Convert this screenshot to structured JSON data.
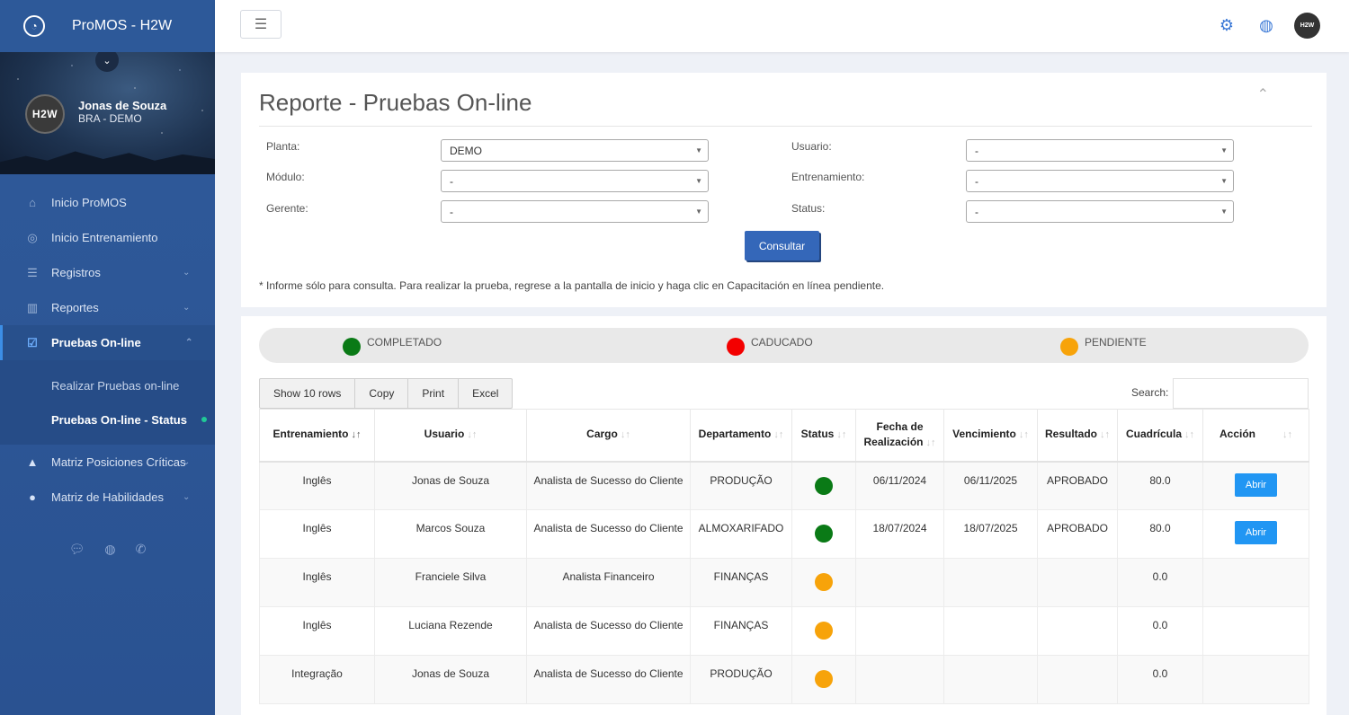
{
  "app": {
    "title": "ProMOS - H2W"
  },
  "profile": {
    "initials": "H2W",
    "name": "Jonas de Souza",
    "org": "BRA - DEMO"
  },
  "menu": [
    {
      "label": "Inicio ProMOS"
    },
    {
      "label": "Inicio Entrenamiento"
    },
    {
      "label": "Registros"
    },
    {
      "label": "Reportes"
    },
    {
      "label": "Pruebas On-line"
    },
    {
      "label": "Matriz Posiciones Críticas"
    },
    {
      "label": "Matriz de Habilidades"
    }
  ],
  "submenu": [
    {
      "label": "Realizar Pruebas on-line"
    },
    {
      "label": "Pruebas On-line - Status"
    }
  ],
  "topbar": {
    "avatar": "H2W"
  },
  "report": {
    "title": "Reporte - Pruebas On-line",
    "filters": {
      "planta": {
        "label": "Planta:",
        "value": "DEMO"
      },
      "modulo": {
        "label": "Módulo:",
        "value": "-"
      },
      "gerente": {
        "label": "Gerente:",
        "value": "-"
      },
      "usuario": {
        "label": "Usuario:",
        "value": "-"
      },
      "entrenamiento": {
        "label": "Entrenamiento:",
        "value": "-"
      },
      "status": {
        "label": "Status:",
        "value": "-"
      }
    },
    "consultar_label": "Consultar",
    "note": "* Informe sólo para consulta. Para realizar la prueba, regrese a la pantalla de inicio y haga clic en Capacitación en línea pendiente."
  },
  "legend": {
    "completado": {
      "label": "COMPLETADO",
      "color": "#0a7a16"
    },
    "caducado": {
      "label": "CADUCADO",
      "color": "#f30000"
    },
    "pendiente": {
      "label": "PENDIENTE",
      "color": "#f7a30a"
    }
  },
  "table_tools": {
    "show_rows": "Show 10 rows",
    "copy": "Copy",
    "print": "Print",
    "excel": "Excel",
    "search_label": "Search:"
  },
  "table": {
    "headers": {
      "entrenamiento": "Entrenamiento",
      "usuario": "Usuario",
      "cargo": "Cargo",
      "departamento": "Departamento",
      "status": "Status",
      "fecha_1": "Fecha de",
      "fecha_2": "Realización",
      "vencimiento": "Vencimiento",
      "resultado": "Resultado",
      "cuadricula": "Cuadrícula",
      "accion": "Acción"
    },
    "action_label": "Abrir",
    "rows": [
      {
        "entrenamiento": "Inglês",
        "usuario": "Jonas de Souza",
        "cargo": "Analista de Sucesso do Cliente",
        "departamento": "PRODUÇÃO",
        "status": "completado",
        "fecha": "06/11/2024",
        "vencimiento": "06/11/2025",
        "resultado": "APROBADO",
        "cuadricula": "80.0",
        "accion": true
      },
      {
        "entrenamiento": "Inglês",
        "usuario": "Marcos Souza",
        "cargo": "Analista de Sucesso do Cliente",
        "departamento": "ALMOXARIFADO",
        "status": "completado",
        "fecha": "18/07/2024",
        "vencimiento": "18/07/2025",
        "resultado": "APROBADO",
        "cuadricula": "80.0",
        "accion": true
      },
      {
        "entrenamiento": "Inglês",
        "usuario": "Franciele Silva",
        "cargo": "Analista Financeiro",
        "departamento": "FINANÇAS",
        "status": "pendiente",
        "fecha": "",
        "vencimiento": "",
        "resultado": "",
        "cuadricula": "0.0",
        "accion": false
      },
      {
        "entrenamiento": "Inglês",
        "usuario": "Luciana Rezende",
        "cargo": "Analista de Sucesso do Cliente",
        "departamento": "FINANÇAS",
        "status": "pendiente",
        "fecha": "",
        "vencimiento": "",
        "resultado": "",
        "cuadricula": "0.0",
        "accion": false
      },
      {
        "entrenamiento": "Integração",
        "usuario": "Jonas de Souza",
        "cargo": "Analista de Sucesso do Cliente",
        "departamento": "PRODUÇÃO",
        "status": "pendiente",
        "fecha": "",
        "vencimiento": "",
        "resultado": "",
        "cuadricula": "0.0",
        "accion": false
      }
    ]
  }
}
